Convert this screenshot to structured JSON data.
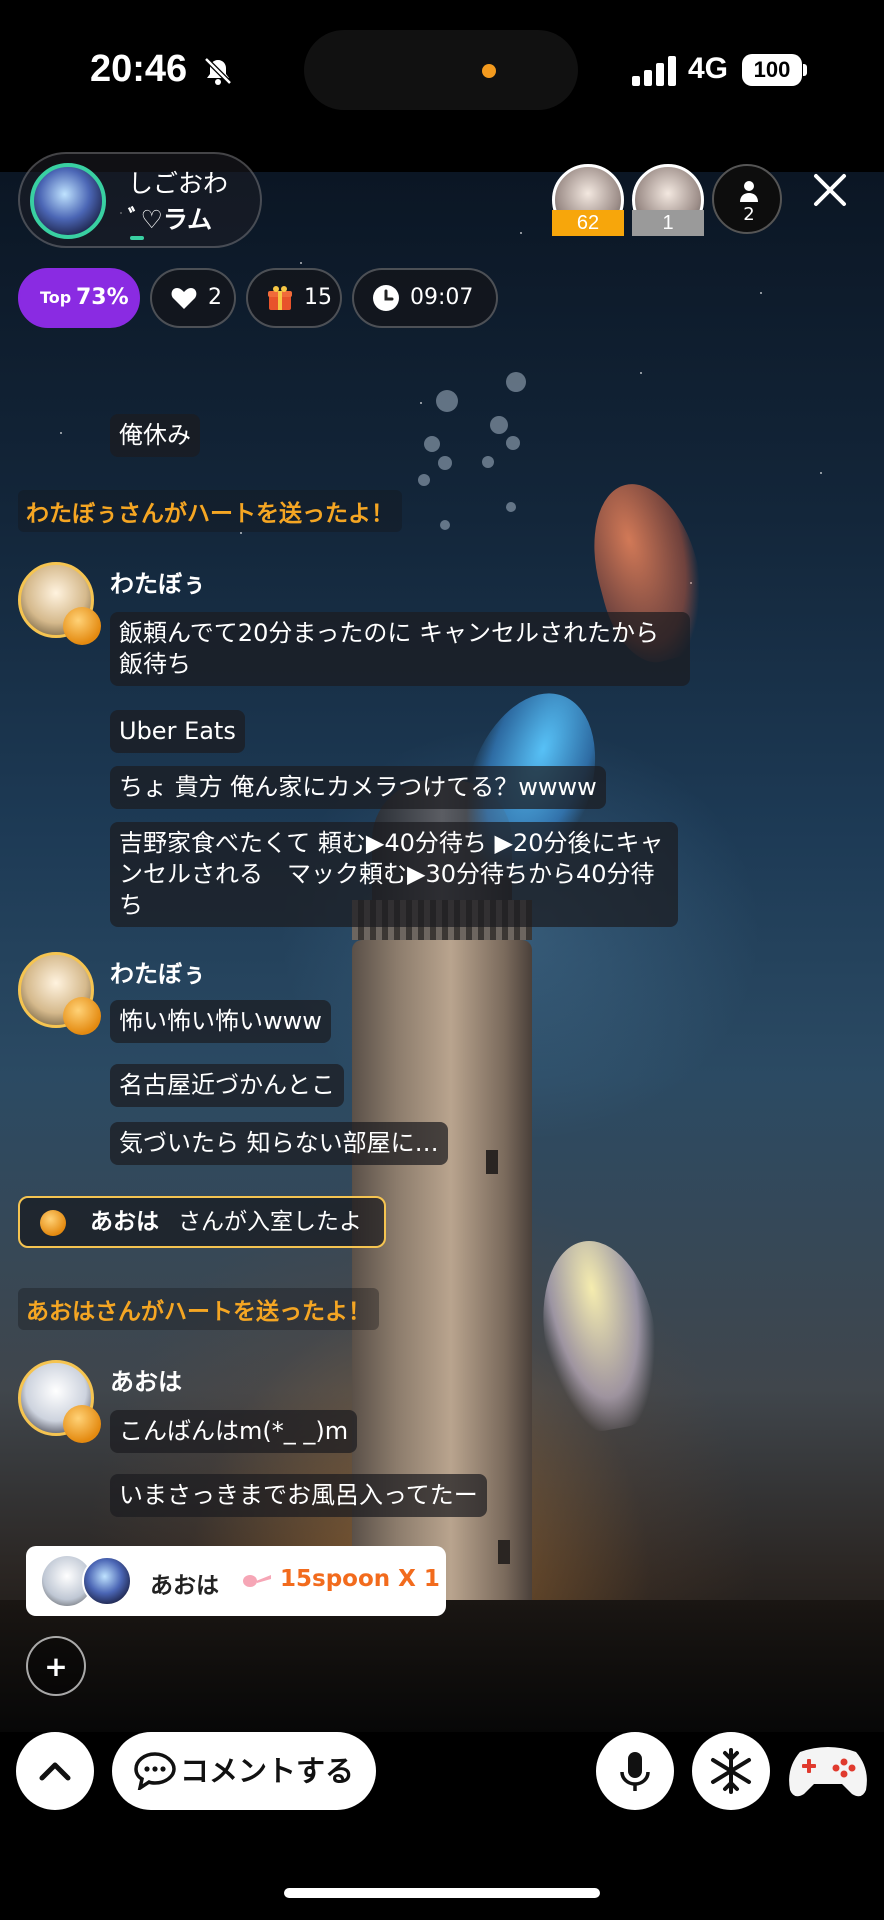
{
  "status_bar": {
    "time": "20:46",
    "network": "4G",
    "battery": "100"
  },
  "host": {
    "name": "しごおわ",
    "subtitle": "ﾞ♡ラム"
  },
  "top_listeners": [
    {
      "badge": "62",
      "badge_color": "#f7a60b"
    },
    {
      "badge": "1",
      "badge_color": "#9a9a9a"
    }
  ],
  "listener_count": "2",
  "stats": {
    "top_label": "Top",
    "top_value": "73%",
    "hearts": "2",
    "gifts": "15",
    "time": "09:07"
  },
  "chat": {
    "m0": "俺休み",
    "sys1": "わたぼぅさんがハートを送ったよ！",
    "user1": "わたぼぅ",
    "u1m1": "飯頼んでて20分まったのに キャンセルされたから飯待ち",
    "u1m2": "Uber Eats",
    "u1m3": "ちょ 貴方 俺ん家にカメラつけてる？wwww",
    "u1m4": "吉野家食べたくて 頼む▶40分待ち ▶20分後にキャンセルされる　マック頼む▶30分待ちから40分待ち",
    "user2": "わたぼぅ",
    "u2m1": "怖い怖い怖いwww",
    "u2m2": "名古屋近づかんとこ",
    "u2m3": "気づいたら 知らない部屋に…",
    "join_name": "あおは",
    "join_text": "さんが入室したよ",
    "sys2": "あおはさんがハートを送ったよ！",
    "user3": "あおは",
    "u3m1": "こんばんはm(*_ _)m",
    "u3m2": "いまさっきまでお風呂入ってたー"
  },
  "gift_notice": {
    "name": "あおは",
    "amount": "15spoon X 1",
    "amount_color": "#f26b1d"
  },
  "bottom_bar": {
    "comment_label": "コメントする",
    "plus": "+"
  },
  "colors": {
    "accent_purple": "#8a2be2",
    "system_text": "#f5a623",
    "join_border": "#f5c451"
  }
}
